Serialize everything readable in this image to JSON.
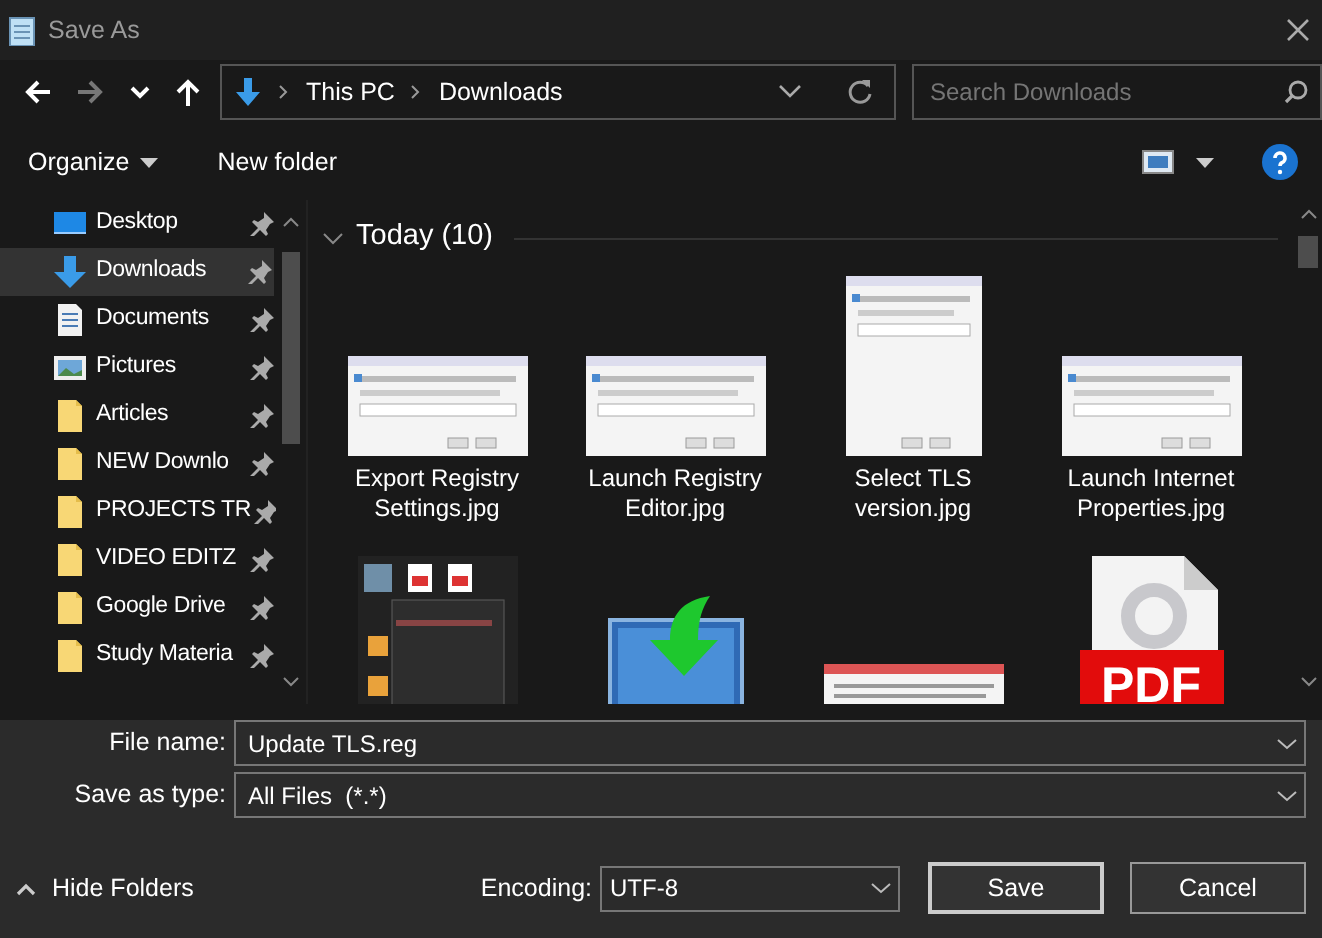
{
  "window": {
    "title": "Save As"
  },
  "nav_buttons": [
    {
      "kind": "back",
      "disabled": false
    },
    {
      "kind": "forward",
      "disabled": true
    },
    {
      "kind": "recent",
      "disabled": false
    },
    {
      "kind": "up",
      "disabled": false
    }
  ],
  "breadcrumb": [
    "This PC",
    "Downloads"
  ],
  "search": {
    "placeholder": "Search Downloads"
  },
  "toolbar": {
    "buttons": [
      "Organize",
      "New folder"
    ]
  },
  "sidebar": {
    "items": [
      {
        "label": "Desktop",
        "kind": "desktop",
        "selected": false,
        "pinned": true
      },
      {
        "label": "Downloads",
        "kind": "downloads",
        "selected": true,
        "pinned": true
      },
      {
        "label": "Documents",
        "kind": "documents",
        "selected": false,
        "pinned": true
      },
      {
        "label": "Pictures",
        "kind": "pictures",
        "selected": false,
        "pinned": true
      },
      {
        "label": "Articles",
        "kind": "folder",
        "selected": false,
        "pinned": true
      },
      {
        "label": "NEW Downlo",
        "kind": "folder",
        "selected": false,
        "pinned": true
      },
      {
        "label": "PROJECTS TR",
        "kind": "folder",
        "selected": false,
        "pinned": true
      },
      {
        "label": "VIDEO EDITZ",
        "kind": "folder",
        "selected": false,
        "pinned": true
      },
      {
        "label": "Google Drive",
        "kind": "folder",
        "selected": false,
        "pinned": true
      },
      {
        "label": "Study Materia",
        "kind": "folder",
        "selected": false,
        "pinned": true
      }
    ]
  },
  "group": {
    "title": "Today (10)",
    "expanded": true
  },
  "files": [
    {
      "name": "Export Registry Settings.jpg",
      "kind": "landscape"
    },
    {
      "name": "Launch Registry Editor.jpg",
      "kind": "landscape"
    },
    {
      "name": "Select TLS version.jpg",
      "kind": "portrait"
    },
    {
      "name": "Launch Internet Properties.jpg",
      "kind": "landscape"
    },
    {
      "kind": "menu"
    },
    {
      "kind": "download"
    },
    {
      "kind": "strip"
    },
    {
      "kind": "pdf",
      "badge": "PDF"
    }
  ],
  "file_name": {
    "label": "File name:",
    "value": "Update TLS.reg"
  },
  "save_as_type": {
    "label": "Save as type:",
    "value": "All Files  (*.*)"
  },
  "hide_folders": "Hide Folders",
  "encoding": {
    "label": "Encoding:",
    "value": "UTF-8"
  },
  "buttons": [
    "Save",
    "Cancel"
  ]
}
